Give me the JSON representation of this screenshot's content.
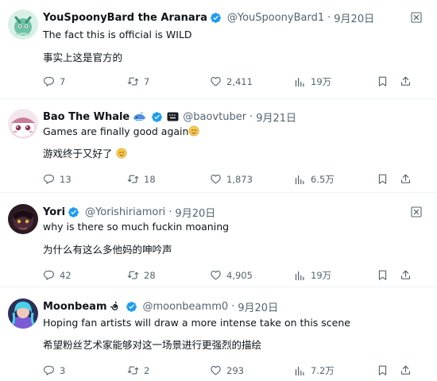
{
  "tweets": [
    {
      "name": "YouSpoonyBard the Aranara",
      "handle": "@YouSpoonyBard1",
      "separator": "·",
      "date": "9月20日",
      "text_en": "The fact this is official is WILD",
      "text_zh": "事实上这是官方的",
      "replies": "7",
      "retweets": "7",
      "likes": "2,411",
      "views": "19万"
    },
    {
      "name": "Bao The Whale",
      "handle": "@baovtuber",
      "separator": "·",
      "date": "9月21日",
      "text_en": "Games are finally good again",
      "text_zh": "游戏终于又好了",
      "replies": "13",
      "retweets": "18",
      "likes": "1,873",
      "views": "6.5万"
    },
    {
      "name": "Yori",
      "handle": "@Yorishiriamori",
      "separator": "·",
      "date": "9月20日",
      "text_en": "why is there so much fuckin moaning",
      "text_zh": "为什么有这么多他妈的呻吟声",
      "replies": "42",
      "retweets": "28",
      "likes": "4,905",
      "views": "19万"
    },
    {
      "name": "Moonbeam",
      "handle": "@moonbeamm0",
      "separator": "·",
      "date": "9月20日",
      "text_en": "Hoping fan artists will draw a more intense take on this scene",
      "text_zh": "希望粉丝艺术家能够对这一场景进行更强烈的描绘",
      "replies": "3",
      "retweets": "2",
      "likes": "293",
      "views": "7.2万"
    }
  ],
  "icons": {
    "verified": "verified-badge-icon",
    "more": "more-options-icon",
    "reply": "reply-icon",
    "retweet": "retweet-icon",
    "like": "like-icon",
    "views": "views-icon",
    "bookmark": "bookmark-icon",
    "share": "share-icon",
    "whale": "whale-emoji-icon",
    "keyboard": "keyboard-icon",
    "smile": "smiling-face-emoji-icon",
    "spiral": "spiral-icon"
  },
  "colors": {
    "text": "#0f1419",
    "muted": "#536471",
    "verified": "#1d9bf0",
    "divider": "#eff3f4"
  }
}
